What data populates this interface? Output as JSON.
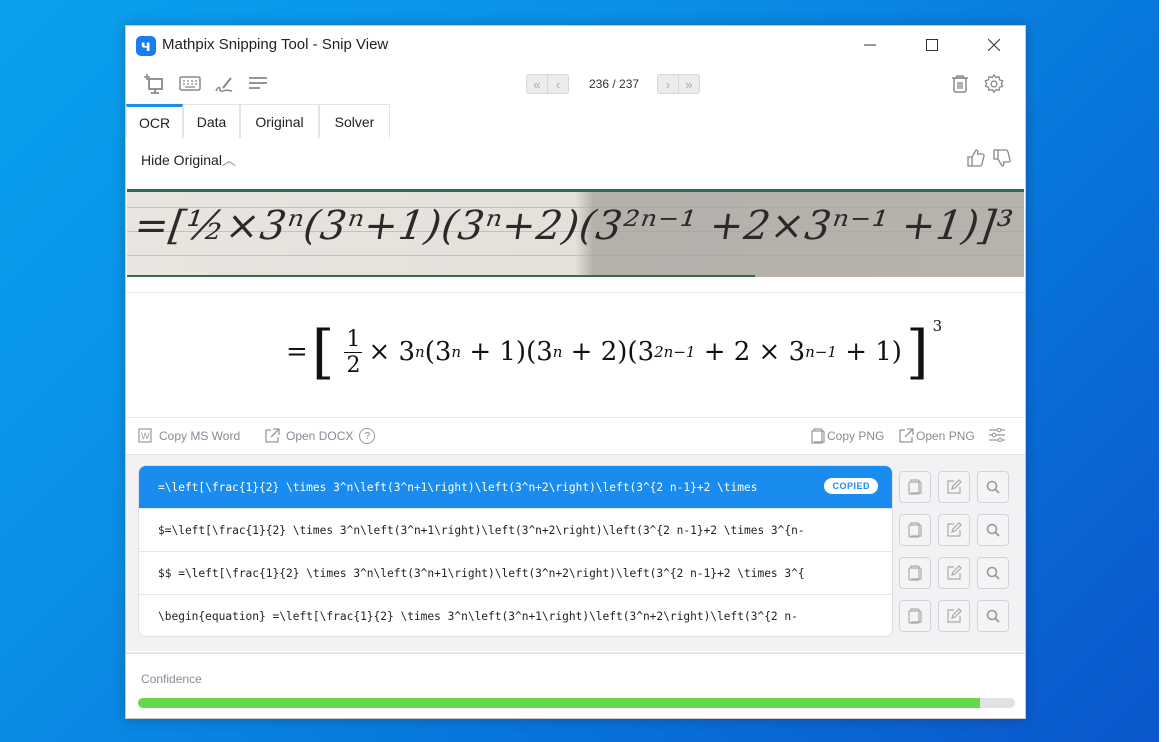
{
  "window": {
    "title": "Mathpix Snipping Tool - Snip View",
    "logo_glyph": "ч",
    "controls": [
      "minimize",
      "maximize",
      "close"
    ]
  },
  "toolbar": {
    "tools": [
      "screenshot-snip",
      "keyboard",
      "handwriting",
      "text-lines"
    ],
    "pager": {
      "current": 236,
      "total": 237,
      "label": "236 / 237",
      "first_glyph": "«",
      "prev_glyph": "‹",
      "next_glyph": "›",
      "last_glyph": "»"
    },
    "right_tools": [
      "delete",
      "settings"
    ]
  },
  "tabs": [
    {
      "label": "OCR",
      "active": true
    },
    {
      "label": "Data",
      "active": false
    },
    {
      "label": "Original",
      "active": false
    },
    {
      "label": "Solver",
      "active": false
    }
  ],
  "original_toggle": {
    "label": "Hide Original",
    "glyph": "︿"
  },
  "feedback": [
    "thumbs-up",
    "thumbs-down"
  ],
  "snip": {
    "handwriting_text": "=[½×3ⁿ(3ⁿ+1)(3ⁿ+2)(3²ⁿ⁻¹ +2×3ⁿ⁻¹ +1)]³"
  },
  "rendered_math": {
    "equals": "=",
    "left_bracket": "[",
    "frac_num": "1",
    "frac_den": "2",
    "body_1": "× 3",
    "sup_n1": "n",
    "body_2": "(3",
    "sup_n2": "n",
    "body_3": " + 1)(3",
    "sup_n3": "n",
    "body_4": " + 2)(3",
    "sup_2n1": "2n−1",
    "body_5": " + 2 × 3",
    "sup_n_1": "n−1",
    "body_6": " + 1)",
    "right_bracket": "]",
    "outer_sup": "3"
  },
  "actions": {
    "copy_ms_word": "Copy MS Word",
    "open_docx": "Open DOCX",
    "help_glyph": "?",
    "copy_png": "Copy PNG",
    "open_png": "Open PNG"
  },
  "results": [
    {
      "text": "=\\left[\\frac{1}{2} \\times 3^n\\left(3^n+1\\right)\\left(3^n+2\\right)\\left(3^{2 n-1}+2 \\times",
      "selected": true,
      "badge": "COPIED"
    },
    {
      "text": "$=\\left[\\frac{1}{2} \\times 3^n\\left(3^n+1\\right)\\left(3^n+2\\right)\\left(3^{2 n-1}+2 \\times 3^{n-",
      "selected": false
    },
    {
      "text": "$$  =\\left[\\frac{1}{2} \\times 3^n\\left(3^n+1\\right)\\left(3^n+2\\right)\\left(3^{2 n-1}+2 \\times 3^{",
      "selected": false
    },
    {
      "text": "\\begin{equation}  =\\left[\\frac{1}{2} \\times 3^n\\left(3^n+1\\right)\\left(3^n+2\\right)\\left(3^{2 n-",
      "selected": false
    }
  ],
  "row_buttons": [
    "copy",
    "edit",
    "search"
  ],
  "confidence": {
    "label": "Confidence",
    "value": 0.96,
    "color": "#64d84a"
  },
  "colors": {
    "accent": "#1a8cf0",
    "confidence_fill": "#64d84a"
  }
}
